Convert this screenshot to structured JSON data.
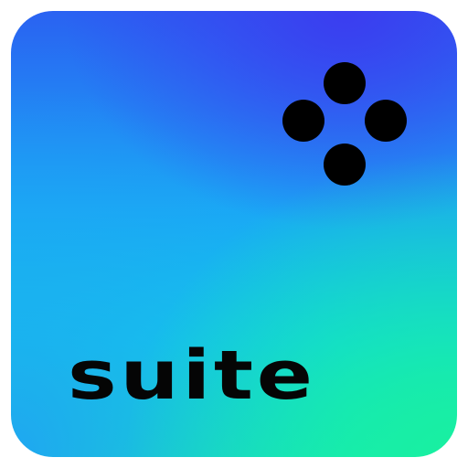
{
  "icon": {
    "wordmark": "suite",
    "logo_mark": "four-dot-diamond-icon",
    "colors": {
      "gradient_top": "#3b3df0",
      "gradient_middle": "#1aa8f5",
      "gradient_bottom": "#19f0a0",
      "mark": "#000000",
      "text": "#050505"
    }
  }
}
